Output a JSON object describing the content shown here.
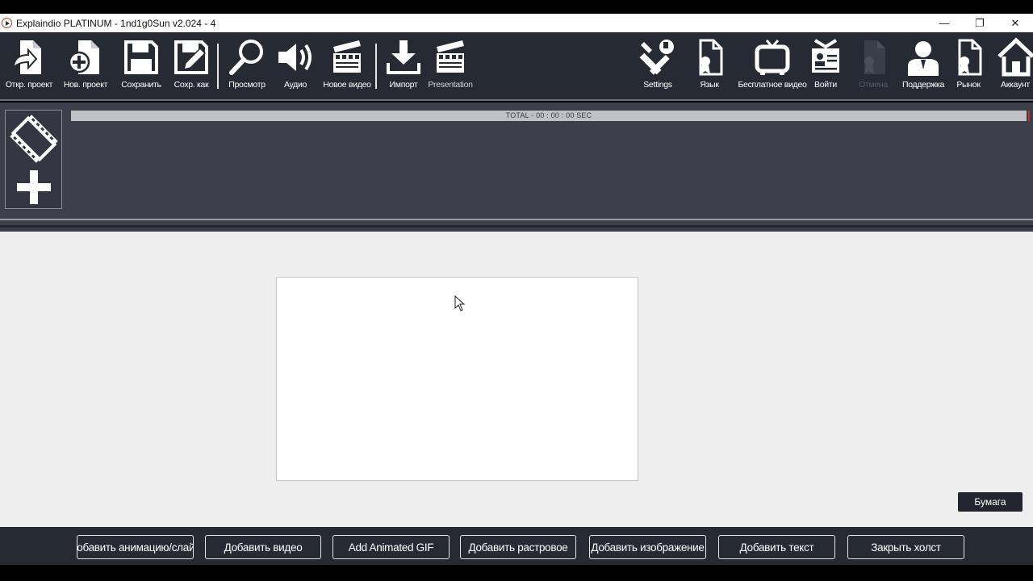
{
  "window": {
    "title": "Explaindio PLATINUM - 1nd1g0Sun v2.024 - 4",
    "minimize": "—",
    "restore": "❐",
    "close": "✕"
  },
  "toolbar": {
    "left": [
      {
        "label": "Откр. проект",
        "icon": "open-project-icon"
      },
      {
        "label": "Нов. проект",
        "icon": "new-project-icon"
      },
      {
        "label": "Сохранить",
        "icon": "save-icon"
      },
      {
        "label": "Сохр. как",
        "icon": "save-as-icon"
      },
      {
        "label": "Просмотр",
        "icon": "magnifier-icon"
      },
      {
        "label": "Аудио",
        "icon": "speaker-icon"
      },
      {
        "label": "Новое видео",
        "icon": "clapperboard-icon"
      },
      {
        "label": "Импорт",
        "icon": "download-icon"
      },
      {
        "label": "Presentation",
        "icon": "clapperboard-icon"
      }
    ],
    "right": [
      {
        "label": "Settings",
        "icon": "tools-icon"
      },
      {
        "label": "Язык",
        "icon": "certificate-icon"
      },
      {
        "label": "Бесплатное видео",
        "icon": "tv-icon"
      },
      {
        "label": "Войти",
        "icon": "id-card-icon"
      },
      {
        "label": "Отмена",
        "icon": "undo-document-icon"
      },
      {
        "label": "Поддержка",
        "icon": "support-person-icon"
      },
      {
        "label": "Рынок",
        "icon": "certificate-icon"
      },
      {
        "label": "Аккаунт",
        "icon": "home-icon"
      }
    ]
  },
  "timeline": {
    "total_label": "TOTAL - 00 : 00 : 00 SEC"
  },
  "workspace": {
    "paper_button": "Бумага"
  },
  "bottom_buttons": [
    "Добавить анимацию/слайд",
    "Добавить видео",
    "Add Animated GIF",
    "Добавить растровое",
    "Добавить изображение",
    "Добавить текст",
    "Закрыть холст"
  ],
  "colors": {
    "toolbar_bg": "#262a33",
    "timeline_bg": "#3c3f49",
    "workspace_bg": "#eeeeee",
    "accent_marker": "#c03030"
  }
}
